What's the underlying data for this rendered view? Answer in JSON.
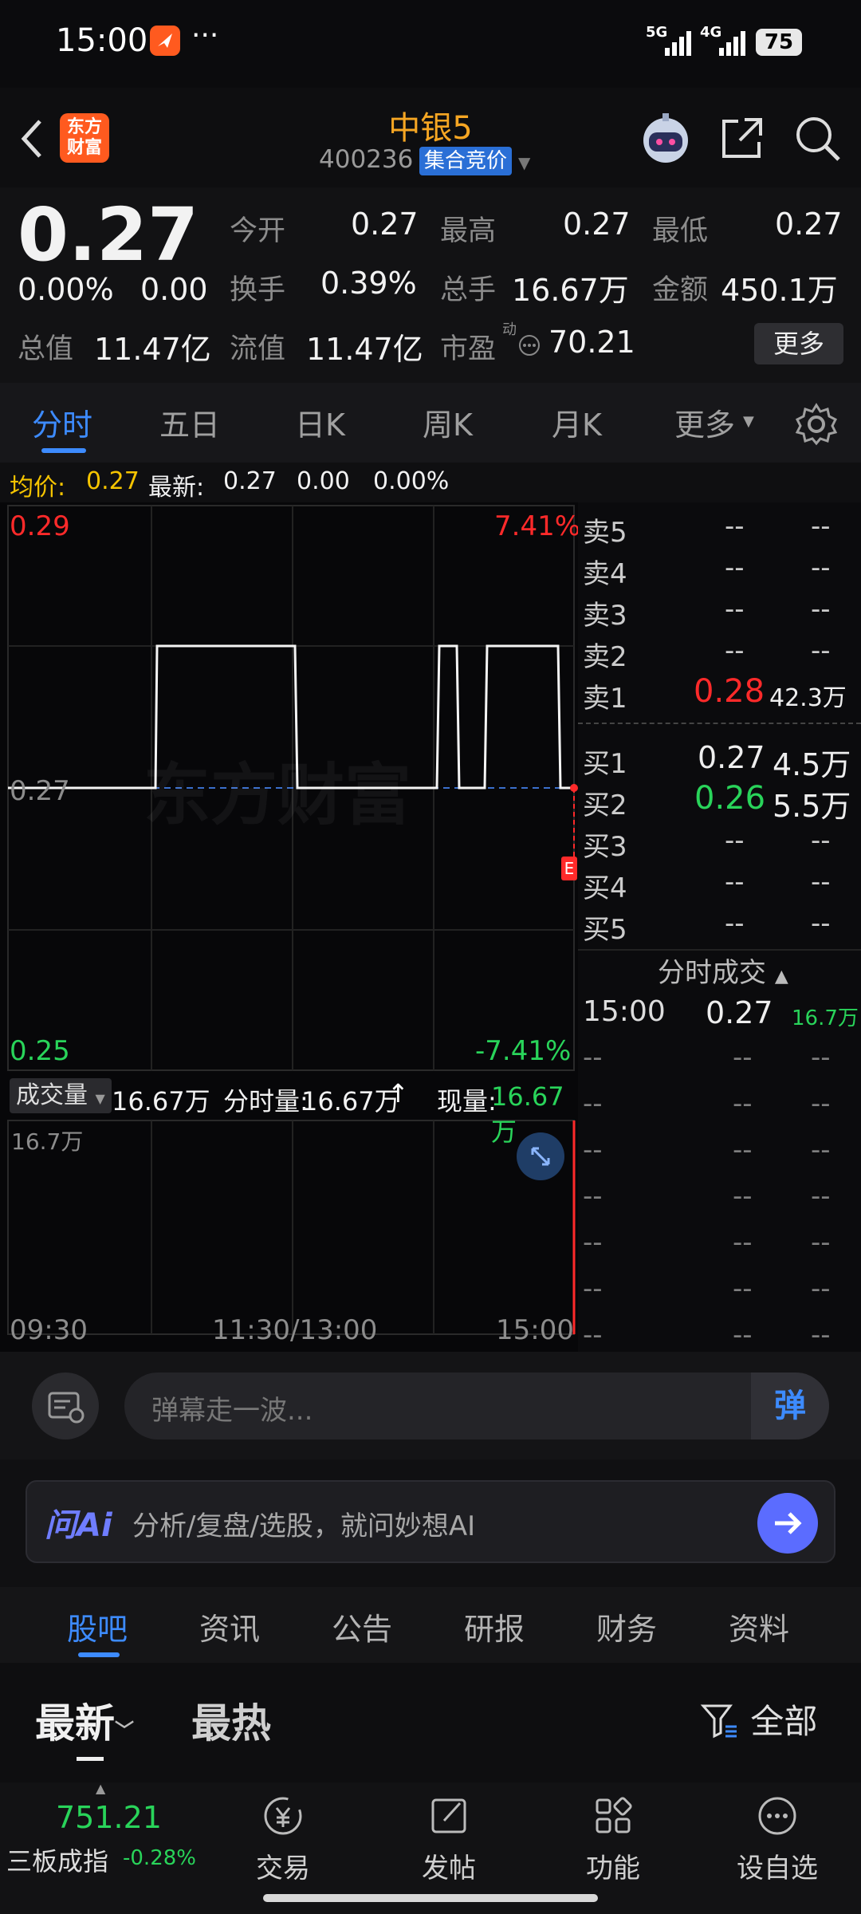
{
  "status": {
    "time": "15:00",
    "battery": "75",
    "signal1": "5G",
    "signal2": "4G",
    "dots": "···"
  },
  "header": {
    "logo_line1": "东方",
    "logo_line2": "财富",
    "title": "中银5",
    "code": "400236",
    "badge": "集合竞价"
  },
  "quote": {
    "price": "0.27",
    "change_pct": "0.00%",
    "change": "0.00",
    "open_label": "今开",
    "open": "0.27",
    "high_label": "最高",
    "high": "0.27",
    "low_label": "最低",
    "low": "0.27",
    "turnover_label": "换手",
    "turnover": "0.39%",
    "volume_label": "总手",
    "volume": "16.67万",
    "amount_label": "金额",
    "amount": "450.1万",
    "mktcap_label": "总值",
    "mktcap": "11.47亿",
    "float_label": "流值",
    "float": "11.47亿",
    "pe_label": "市盈",
    "pe_sup": "动",
    "pe": "70.21",
    "more_button": "更多"
  },
  "tabs": [
    "分时",
    "五日",
    "日K",
    "周K",
    "月K",
    "更多"
  ],
  "infoline": {
    "avg_label": "均价:",
    "avg": "0.27",
    "latest_label": "最新:",
    "latest": "0.27",
    "chg": "0.00",
    "chg_pct": "0.00%"
  },
  "chart": {
    "y_top": "0.29",
    "y_mid": "0.27",
    "y_bottom": "0.25",
    "pct_top": "7.41%",
    "pct_bottom": "-7.41%",
    "watermark": "东方财富",
    "vol_selector": "成交量",
    "vol_value": "16.67万",
    "tick_vol_label": "分时量:",
    "tick_vol": "16.67万",
    "cur_vol_label": "现量:",
    "cur_vol": "16.67万",
    "vol_axis": "16.7万",
    "x_start": "09:30",
    "x_mid": "11:30/13:00",
    "x_end": "15:00",
    "e_marker": "E"
  },
  "chart_data": {
    "type": "line",
    "x": [
      "09:30",
      "11:30/13:00",
      "15:00"
    ],
    "ylim": [
      0.25,
      0.29
    ],
    "y_ticks": [
      "0.29",
      "0.27",
      "0.25"
    ],
    "series": [],
    "volume_max": "16.7万"
  },
  "orderbook": {
    "asks": [
      {
        "label": "卖5",
        "price": "--",
        "vol": "--"
      },
      {
        "label": "卖4",
        "price": "--",
        "vol": "--"
      },
      {
        "label": "卖3",
        "price": "--",
        "vol": "--"
      },
      {
        "label": "卖2",
        "price": "--",
        "vol": "--"
      },
      {
        "label": "卖1",
        "price": "0.28",
        "vol": "42.3万"
      }
    ],
    "bids": [
      {
        "label": "买1",
        "price": "0.27",
        "vol": "4.5万"
      },
      {
        "label": "买2",
        "price": "0.26",
        "vol": "5.5万"
      },
      {
        "label": "买3",
        "price": "--",
        "vol": "--"
      },
      {
        "label": "买4",
        "price": "--",
        "vol": "--"
      },
      {
        "label": "买5",
        "price": "--",
        "vol": "--"
      }
    ]
  },
  "trades": {
    "title": "分时成交",
    "first": {
      "time": "15:00",
      "price": "0.27",
      "vol": "16.7万"
    },
    "dash": "--"
  },
  "danmu": {
    "placeholder": "弹幕走一波...",
    "button": "弹"
  },
  "ai": {
    "logo": "问Ai",
    "placeholder": "分析/复盘/选股，就问妙想AI"
  },
  "section_tabs": [
    "股吧",
    "资讯",
    "公告",
    "研报",
    "财务",
    "资料"
  ],
  "sort": {
    "latest": "最新",
    "hot": "最热",
    "filter": "全部"
  },
  "bottomnav": {
    "index_value": "751.21",
    "index_name": "三板成指",
    "index_change": "-0.28%",
    "trade": "交易",
    "post": "发帖",
    "function": "功能",
    "watch": "设自选"
  },
  "colors": {
    "up": "#ff2a2a",
    "down": "#29d45a",
    "accent": "#3b82f6",
    "avg": "#f5c400"
  }
}
